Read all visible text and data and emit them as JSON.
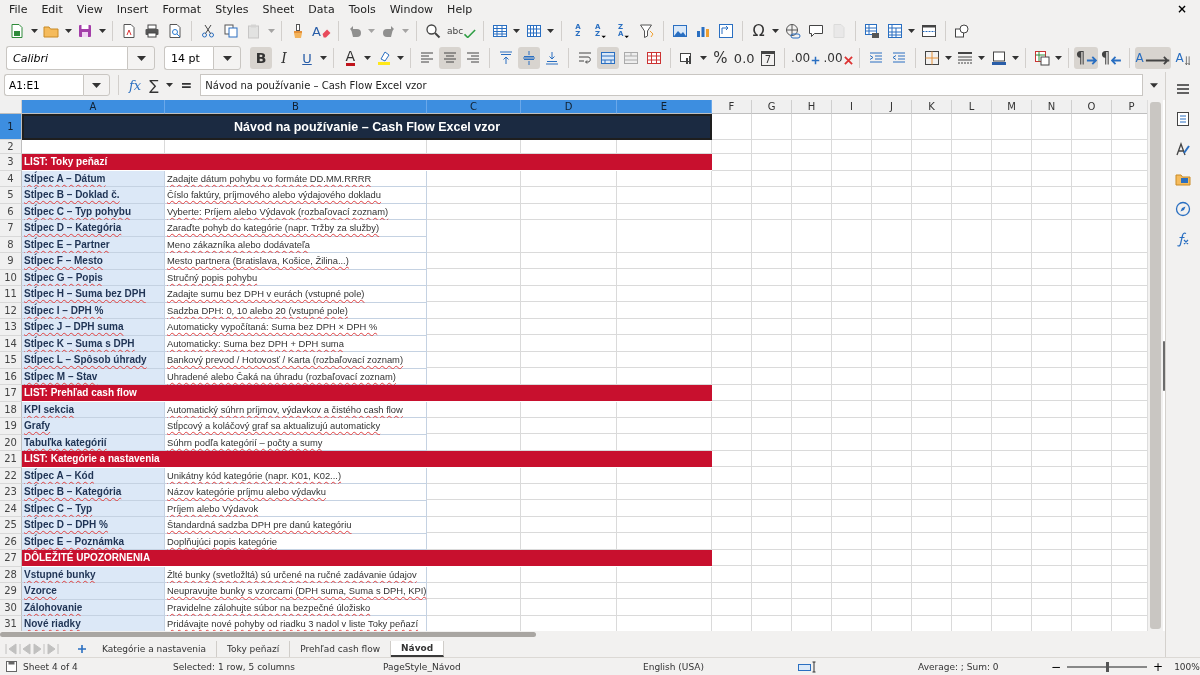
{
  "menu": [
    "File",
    "Edit",
    "View",
    "Insert",
    "Format",
    "Styles",
    "Sheet",
    "Data",
    "Tools",
    "Window",
    "Help"
  ],
  "close_glyph": "×",
  "toolbar1": [
    {
      "kind": "new",
      "dropdown": true,
      "disabled": false
    },
    {
      "kind": "open",
      "dropdown": true,
      "disabled": false
    },
    {
      "kind": "save",
      "dropdown": true,
      "disabled": false
    },
    {
      "kind": "sep"
    },
    {
      "kind": "pdf",
      "disabled": false
    },
    {
      "kind": "print",
      "disabled": false
    },
    {
      "kind": "preview",
      "disabled": false
    },
    {
      "kind": "sep"
    },
    {
      "kind": "cut",
      "disabled": false
    },
    {
      "kind": "copy",
      "disabled": false
    },
    {
      "kind": "paste",
      "dropdown": true,
      "disabled": true
    },
    {
      "kind": "sep"
    },
    {
      "kind": "clone",
      "disabled": false
    },
    {
      "kind": "clear",
      "label": "A",
      "disabled": false
    },
    {
      "kind": "sep"
    },
    {
      "kind": "undo",
      "dropdown": true,
      "disabled": true
    },
    {
      "kind": "redo",
      "dropdown": true,
      "disabled": true
    },
    {
      "kind": "sep"
    },
    {
      "kind": "find",
      "disabled": false
    },
    {
      "kind": "spell",
      "label": "abc",
      "disabled": false
    },
    {
      "kind": "sep"
    },
    {
      "kind": "rows",
      "dropdown": true,
      "disabled": false
    },
    {
      "kind": "cols",
      "dropdown": true,
      "disabled": false
    },
    {
      "kind": "sep"
    },
    {
      "kind": "sort",
      "label": "AZ",
      "disabled": false
    },
    {
      "kind": "sortasc",
      "label": "AZ",
      "disabled": false
    },
    {
      "kind": "sortdesc",
      "label": "ZA",
      "disabled": false
    },
    {
      "kind": "filter",
      "disabled": false
    },
    {
      "kind": "sep"
    },
    {
      "kind": "image",
      "disabled": false
    },
    {
      "kind": "chart",
      "disabled": false
    },
    {
      "kind": "pivot",
      "disabled": false
    },
    {
      "kind": "sep"
    },
    {
      "kind": "special",
      "label": "Ω",
      "dropdown": true,
      "disabled": false
    },
    {
      "kind": "link",
      "disabled": false
    },
    {
      "kind": "comment",
      "disabled": false
    },
    {
      "kind": "headerfooter",
      "disabled": true
    },
    {
      "kind": "sep"
    },
    {
      "kind": "printarea",
      "disabled": false
    },
    {
      "kind": "freeze",
      "dropdown": true,
      "disabled": false
    },
    {
      "kind": "split",
      "disabled": false
    },
    {
      "kind": "sep"
    },
    {
      "kind": "shapes",
      "disabled": false
    }
  ],
  "toolbar2": {
    "font_name": "Calibri",
    "font_size": "14 pt",
    "items": [
      {
        "kind": "bold",
        "label": "B",
        "on": true
      },
      {
        "kind": "italic",
        "label": "I",
        "on": false
      },
      {
        "kind": "underline",
        "label": "U",
        "dropdown": true,
        "on": false
      },
      {
        "kind": "sep"
      },
      {
        "kind": "fontcolor",
        "label": "A",
        "dropdown": true,
        "on": false
      },
      {
        "kind": "highlight",
        "dropdown": true,
        "on": false
      },
      {
        "kind": "sep"
      },
      {
        "kind": "alignleft",
        "on": false
      },
      {
        "kind": "aligncenter",
        "on": true
      },
      {
        "kind": "alignright",
        "on": false
      },
      {
        "kind": "sep"
      },
      {
        "kind": "aligntop",
        "on": false
      },
      {
        "kind": "alignmiddle",
        "on": true
      },
      {
        "kind": "alignbottom",
        "on": false
      },
      {
        "kind": "sep"
      },
      {
        "kind": "wrap",
        "on": false
      },
      {
        "kind": "mergecenter",
        "on": true
      },
      {
        "kind": "merge",
        "on": false
      },
      {
        "kind": "unmerge",
        "on": false
      },
      {
        "kind": "sep"
      },
      {
        "kind": "numfmt",
        "dropdown": true,
        "on": false
      },
      {
        "kind": "percent",
        "label": "%",
        "on": false
      },
      {
        "kind": "number",
        "label": "0.0",
        "on": false
      },
      {
        "kind": "date",
        "label": "7",
        "on": false
      },
      {
        "kind": "sep"
      },
      {
        "kind": "adddec",
        "label": ".00",
        "on": false
      },
      {
        "kind": "deldec",
        "label": ".00",
        "on": false
      },
      {
        "kind": "sep"
      },
      {
        "kind": "indent",
        "on": false
      },
      {
        "kind": "outdent",
        "on": false
      },
      {
        "kind": "sep"
      },
      {
        "kind": "borders",
        "dropdown": true,
        "on": false
      },
      {
        "kind": "borderstyle",
        "dropdown": true,
        "on": false
      },
      {
        "kind": "bordercolor",
        "dropdown": true,
        "on": false
      },
      {
        "kind": "sep"
      },
      {
        "kind": "cond",
        "dropdown": true,
        "on": false
      },
      {
        "kind": "sep"
      },
      {
        "kind": "ltr",
        "label": "¶",
        "on": true
      },
      {
        "kind": "rtl",
        "label": "¶",
        "on": false
      },
      {
        "kind": "sep"
      },
      {
        "kind": "wraptext",
        "label": "A",
        "on": true
      },
      {
        "kind": "vertical",
        "label": "A",
        "on": false
      }
    ]
  },
  "formula_bar": {
    "name_box": "A1:E1",
    "fx": "fx",
    "sum": "∑",
    "equals": "=",
    "value": "Návod na používanie – Cash Flow Excel vzor"
  },
  "columns": [
    {
      "label": "A",
      "selected": true
    },
    {
      "label": "B",
      "selected": true
    },
    {
      "label": "C",
      "selected": true
    },
    {
      "label": "D",
      "selected": true
    },
    {
      "label": "E",
      "selected": true
    },
    {
      "label": "F",
      "selected": false
    },
    {
      "label": "G",
      "selected": false
    },
    {
      "label": "H",
      "selected": false
    },
    {
      "label": "I",
      "selected": false
    },
    {
      "label": "J",
      "selected": false
    },
    {
      "label": "K",
      "selected": false
    },
    {
      "label": "L",
      "selected": false
    },
    {
      "label": "M",
      "selected": false
    },
    {
      "label": "N",
      "selected": false
    },
    {
      "label": "O",
      "selected": false
    },
    {
      "label": "P",
      "selected": false
    }
  ],
  "rows": [
    {
      "number": "1",
      "kind": "title",
      "title": "Návod na používanie – Cash Flow Excel vzor",
      "selected": true
    },
    {
      "number": "2",
      "kind": "blank",
      "selected": false
    },
    {
      "number": "3",
      "kind": "section",
      "text": "LIST: Toky peňazí",
      "selected": false
    },
    {
      "number": "4",
      "kind": "entry",
      "a": "Stĺpec A – Dátum",
      "b": "Zadajte dátum pohybu vo formáte DD.MM.RRRR",
      "selected": false
    },
    {
      "number": "5",
      "kind": "entry",
      "a": "Stĺpec B – Doklad č.",
      "b": "Číslo faktúry, príjmového alebo výdajového dokladu",
      "selected": false
    },
    {
      "number": "6",
      "kind": "entry",
      "a": "Stĺpec C – Typ pohybu",
      "b": "Vyberte: Príjem alebo Výdavok (rozbaľovací zoznam)",
      "selected": false
    },
    {
      "number": "7",
      "kind": "entry",
      "a": "Stĺpec D – Kategória",
      "b": "Zaraďte pohyb do kategórie (napr. Tržby za služby)",
      "selected": false
    },
    {
      "number": "8",
      "kind": "entry",
      "a": "Stĺpec E – Partner",
      "b": "Meno zákazníka alebo dodávateľa",
      "selected": false
    },
    {
      "number": "9",
      "kind": "entry",
      "a": "Stĺpec F – Mesto",
      "b": "Mesto partnera (Bratislava, Košice, Žilina...)",
      "selected": false
    },
    {
      "number": "10",
      "kind": "entry",
      "a": "Stĺpec G – Popis",
      "b": "Stručný popis pohybu",
      "selected": false
    },
    {
      "number": "11",
      "kind": "entry",
      "a": "Stĺpec H – Suma bez DPH",
      "b": "Zadajte sumu bez DPH v eurách (vstupné pole)",
      "selected": false
    },
    {
      "number": "12",
      "kind": "entry",
      "a": "Stĺpec I – DPH %",
      "b": "Sadzba DPH: 0, 10 alebo 20 (vstupné pole)",
      "selected": false
    },
    {
      "number": "13",
      "kind": "entry",
      "a": "Stĺpec J – DPH suma",
      "b": "Automaticky vypočítaná: Suma bez DPH × DPH %",
      "selected": false
    },
    {
      "number": "14",
      "kind": "entry",
      "a": "Stĺpec K – Suma s DPH",
      "b": "Automaticky: Suma bez DPH + DPH suma",
      "selected": false
    },
    {
      "number": "15",
      "kind": "entry",
      "a": "Stĺpec L – Spôsob úhrady",
      "b": "Bankový prevod / Hotovosť / Karta (rozbaľovací zoznam)",
      "selected": false
    },
    {
      "number": "16",
      "kind": "entry",
      "a": "Stĺpec M – Stav",
      "b": "Uhradené alebo Čaká na úhradu (rozbaľovací zoznam)",
      "selected": false
    },
    {
      "number": "17",
      "kind": "section",
      "text": "LIST: Prehľad cash flow",
      "selected": false
    },
    {
      "number": "18",
      "kind": "entry",
      "a": "KPI sekcia",
      "b": "Automatický súhrn príjmov, výdavkov a čistého cash flow",
      "selected": false
    },
    {
      "number": "19",
      "kind": "entry",
      "a": "Grafy",
      "b": "Stĺpcový a koláčový graf sa aktualizujú automaticky",
      "selected": false
    },
    {
      "number": "20",
      "kind": "entry",
      "a": "Tabuľka kategórií",
      "b": "Súhrn podľa kategórií – počty a sumy",
      "selected": false
    },
    {
      "number": "21",
      "kind": "section",
      "text": "LIST: Kategórie a nastavenia",
      "selected": false
    },
    {
      "number": "22",
      "kind": "entry",
      "a": "Stĺpec A – Kód",
      "b": "Unikátny kód kategórie (napr. K01, K02...)",
      "selected": false
    },
    {
      "number": "23",
      "kind": "entry",
      "a": "Stĺpec B – Kategória",
      "b": "Názov kategórie príjmu alebo výdavku",
      "selected": false
    },
    {
      "number": "24",
      "kind": "entry",
      "a": "Stĺpec C – Typ",
      "b": "Príjem alebo Výdavok",
      "selected": false
    },
    {
      "number": "25",
      "kind": "entry",
      "a": "Stĺpec D – DPH %",
      "b": "Štandardná sadzba DPH pre danú kategóriu",
      "selected": false
    },
    {
      "number": "26",
      "kind": "entry",
      "a": "Stĺpec E – Poznámka",
      "b": "Doplňujúci popis kategórie",
      "selected": false
    },
    {
      "number": "27",
      "kind": "section",
      "text": "DÔLEŽITÉ UPOZORNENIA",
      "selected": false
    },
    {
      "number": "28",
      "kind": "entry",
      "a": "Vstupné bunky",
      "b": "Žlté bunky (svetložltá) sú určené na ručné zadávanie údajov",
      "selected": false
    },
    {
      "number": "29",
      "kind": "entry",
      "a": "Vzorce",
      "b": "Neupravujte bunky s vzorcami (DPH suma, Suma s DPH, KPI)",
      "selected": false
    },
    {
      "number": "30",
      "kind": "entry",
      "a": "Zálohovanie",
      "b": "Pravidelne zálohujte súbor na bezpečné úložisko",
      "selected": false
    },
    {
      "number": "31",
      "kind": "entry",
      "a": "Nové riadky",
      "b": "Pridávajte nové pohyby od riadku 3 nadol v liste Toky peňazí",
      "selected": false
    }
  ],
  "sheet_tabs": [
    {
      "label": "Kategórie a nastavenia",
      "selected": false
    },
    {
      "label": "Toky peňazí",
      "selected": false
    },
    {
      "label": "Prehľad cash flow",
      "selected": false
    },
    {
      "label": "Návod",
      "selected": true
    }
  ],
  "status_bar": {
    "sheet": "Sheet 4 of 4",
    "selection": "Selected: 1 row, 5 columns",
    "page_style": "PageStyle_Návod",
    "language": "English (USA)",
    "summary": "Average: ; Sum: 0",
    "zoom_out": "−",
    "zoom_in": "+",
    "zoom": {
      "level": 0.5,
      "reading": "100%"
    }
  }
}
